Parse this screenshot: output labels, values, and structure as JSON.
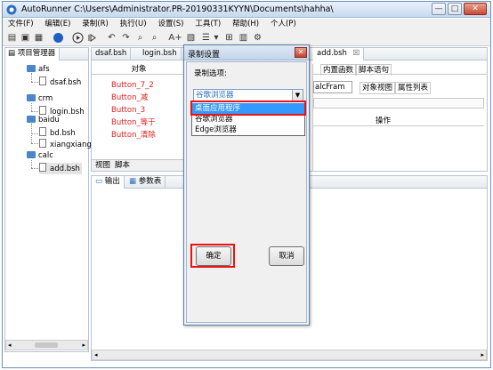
{
  "window": {
    "app_name": "AutoRunner",
    "path": "C:\\Users\\Administrator.PR-20190331KYYN\\Documents\\hahha\\",
    "min": "—",
    "max": "□",
    "close": "✕"
  },
  "menu": [
    "文件(F)",
    "编辑(E)",
    "录制(R)",
    "执行(U)",
    "设置(S)",
    "工具(T)",
    "帮助(H)",
    "个人(P)"
  ],
  "toolbar": {
    "text_tool": "A+"
  },
  "project": {
    "tab_label": "项目管理器",
    "tree": [
      {
        "label": "afs",
        "kind": "folder"
      },
      {
        "label": "dsaf.bsh",
        "kind": "file"
      },
      {
        "label": "crm",
        "kind": "folder"
      },
      {
        "label": "login.bsh",
        "kind": "file"
      },
      {
        "label": "baidu",
        "kind": "folder"
      },
      {
        "label": "bd.bsh",
        "kind": "file"
      },
      {
        "label": "xiangxiang",
        "kind": "file"
      },
      {
        "label": "calc",
        "kind": "folder"
      },
      {
        "label": "add.bsh",
        "kind": "file"
      }
    ]
  },
  "editor": {
    "tabs": [
      "dsaf.bsh",
      "login.bsh",
      "add.bsh"
    ],
    "tab_close": "☒",
    "object_header": "对象",
    "objects": [
      "Button_7_2",
      "Button_减",
      "Button_3",
      "Button_等于",
      "Button_清除"
    ],
    "bottom_tabs": [
      "视图",
      "脚本"
    ]
  },
  "right_panel": {
    "tabs": [
      "内置函数",
      "脚本语句"
    ],
    "combo_value": "alcFram",
    "subtabs": [
      "对象视图",
      "属性列表"
    ],
    "operation_header": "操作"
  },
  "output": {
    "tabs": [
      "输出",
      "参数表"
    ]
  },
  "dialog": {
    "title": "录制设置",
    "close": "✕",
    "label": "录制选项:",
    "combo_value": "谷歌浏览器",
    "options": [
      "桌面应用程序",
      "谷歌浏览器",
      "Edge浏览器"
    ],
    "selected_index": 0,
    "ok": "确定",
    "cancel": "取消"
  },
  "colors": {
    "accent": "#3399ff",
    "object_text": "#e02020",
    "highlight_box": "#ee1111"
  }
}
